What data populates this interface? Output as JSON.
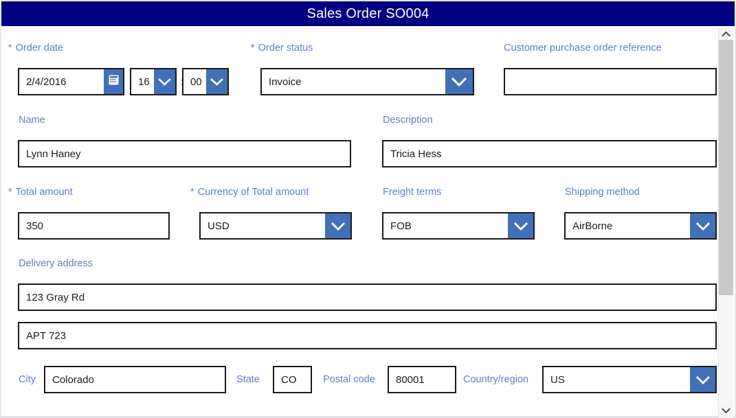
{
  "window": {
    "title": "Sales Order SO004"
  },
  "form": {
    "order_date": {
      "label": "Order date",
      "required_marker": "*",
      "date_value": "2/4/2016",
      "calendar_icon": "calendar-icon",
      "hour_value": "16",
      "time_separator": ":",
      "minute_value": "00",
      "dropdown_icon": "chevron-down-icon"
    },
    "order_status": {
      "label": "Order status",
      "required_marker": "*",
      "value": "Invoice",
      "dropdown_icon": "chevron-down-icon"
    },
    "customer_po_reference": {
      "label": "Customer purchase order reference",
      "value": "",
      "placeholder": ""
    },
    "name": {
      "label": "Name",
      "value": "Lynn Haney"
    },
    "description": {
      "label": "Description",
      "value": "Tricia Hess"
    },
    "total_amount": {
      "label": "Total amount",
      "required_marker": "*",
      "value": "350"
    },
    "currency": {
      "label": "Currency of Total amount",
      "required_marker": "*",
      "value": "USD",
      "dropdown_icon": "chevron-down-icon"
    },
    "freight_terms": {
      "label": "Freight terms",
      "value": "FOB",
      "dropdown_icon": "chevron-down-icon"
    },
    "shipping_method": {
      "label": "Shipping method",
      "value": "AirBorne",
      "dropdown_icon": "chevron-down-icon"
    },
    "delivery_address": {
      "label": "Delivery address",
      "line1_value": "123 Gray Rd",
      "line2_value": "APT 723"
    },
    "city": {
      "label": "City",
      "value": "Colorado"
    },
    "state": {
      "label": "State",
      "value": "CO"
    },
    "postal_code": {
      "label": "Postal code",
      "value": "80001"
    },
    "country_region": {
      "label": "Country/region",
      "value": "US",
      "dropdown_icon": "chevron-down-icon"
    }
  },
  "scrollbar": {
    "up_icon": "chevron-up-icon",
    "down_icon": "chevron-down-icon"
  },
  "colors": {
    "titlebar_bg": "#000080",
    "label_text": "#5f7fc6",
    "accent_button": "#4270b8",
    "field_border": "#1a1a1a",
    "scroll_thumb": "#c9c9c9"
  }
}
